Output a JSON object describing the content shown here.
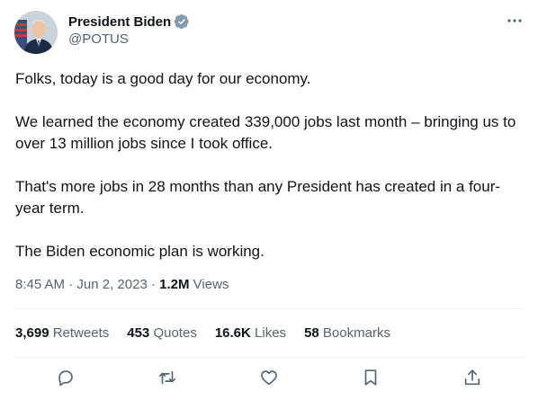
{
  "author": {
    "display_name": "President Biden",
    "handle": "@POTUS",
    "verified": true,
    "verified_color": "#829aab"
  },
  "tweet": {
    "paragraphs": [
      "Folks, today is a good day for our economy.",
      "We learned the economy created 339,000 jobs last month – bringing us to over 13 million jobs since I took office.",
      "That's more jobs in 28 months than any President has created in a four-year term.",
      "The Biden economic plan is working."
    ]
  },
  "meta": {
    "time": "8:45 AM",
    "separator": "·",
    "date": "Jun 2, 2023",
    "views_count": "1.2M",
    "views_label": "Views"
  },
  "stats": {
    "retweets_count": "3,699",
    "retweets_label": "Retweets",
    "quotes_count": "453",
    "quotes_label": "Quotes",
    "likes_count": "16.6K",
    "likes_label": "Likes",
    "bookmarks_count": "58",
    "bookmarks_label": "Bookmarks"
  },
  "icons": {
    "more": "more-icon",
    "reply": "reply-icon",
    "retweet": "retweet-icon",
    "like": "like-icon",
    "bookmark": "bookmark-icon",
    "share": "share-icon"
  },
  "colors": {
    "text": "#0f1419",
    "secondary": "#536471",
    "divider": "#eff3f4"
  }
}
